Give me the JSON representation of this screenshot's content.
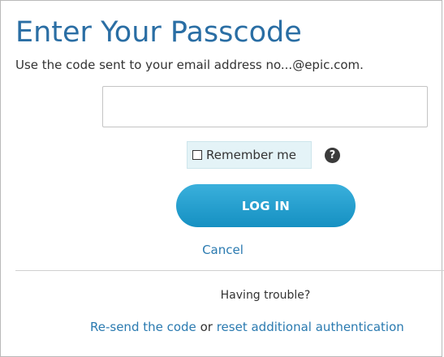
{
  "page": {
    "title": "Enter Your Passcode",
    "instructions": "Use the code sent to your email address no...@epic.com."
  },
  "form": {
    "passcode_value": "",
    "passcode_placeholder": "",
    "remember_me_label": "Remember me",
    "remember_me_checked": false,
    "help_glyph": "?",
    "login_label": "LOG IN",
    "cancel_label": "Cancel"
  },
  "trouble": {
    "heading": "Having trouble?",
    "resend_label": "Re-send the code",
    "or_text": "or",
    "reset_label": "reset additional authentication"
  },
  "icons": {
    "help": "question-circle-icon",
    "checkbox": "checkbox-unchecked-icon"
  },
  "colors": {
    "title": "#2a6ea4",
    "link": "#2a7ab0",
    "button": "#1d9fd0",
    "remember_bg": "#e4f3f7"
  }
}
